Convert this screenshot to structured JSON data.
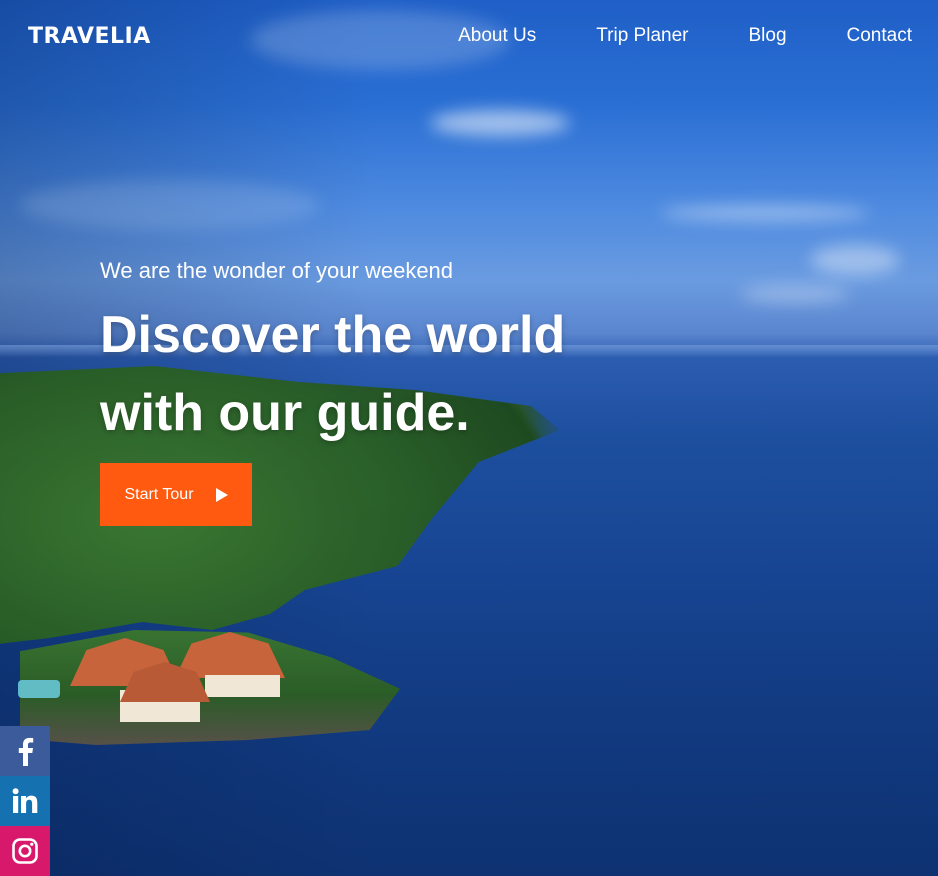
{
  "brand": {
    "logo_text": "TRAVELIA"
  },
  "nav": {
    "items": [
      {
        "label": "About Us"
      },
      {
        "label": "Trip Planer"
      },
      {
        "label": "Blog"
      },
      {
        "label": "Contact"
      }
    ]
  },
  "hero": {
    "tagline": "We are the wonder of your weekend",
    "headline_line1": "Discover the world",
    "headline_line2": "with our guide.",
    "cta_label": "Start Tour",
    "cta_icon": "play-icon"
  },
  "social": {
    "items": [
      {
        "icon": "facebook-icon",
        "color": "#3b5b9a"
      },
      {
        "icon": "linkedin-icon",
        "color": "#1571b0"
      },
      {
        "icon": "instagram-icon",
        "color": "#d8196b"
      }
    ]
  },
  "colors": {
    "accent": "#ff5a0f",
    "text": "#ffffff"
  }
}
